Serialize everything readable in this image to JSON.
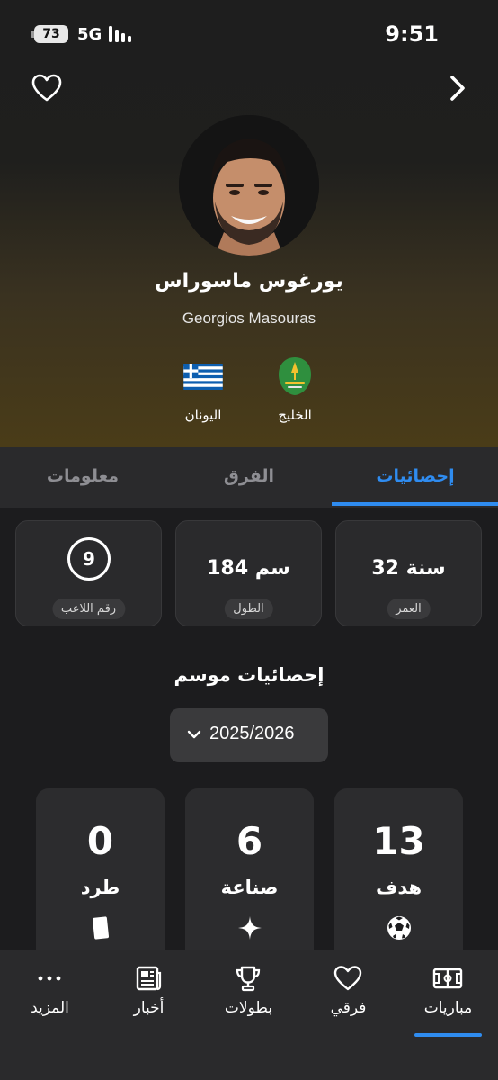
{
  "status_bar": {
    "battery": "73",
    "network": "5G",
    "time": "9:51"
  },
  "header": {
    "favorite_icon": "heart-outline-icon",
    "back_icon": "chevron-right-icon",
    "player_name_ar": "يورغوس ماسوراس",
    "player_name_en": "Georgios Masouras",
    "country": "اليونان",
    "club": "الخليج"
  },
  "tabs": [
    {
      "label": "إحصائيات",
      "active": true
    },
    {
      "label": "الفرق",
      "active": false
    },
    {
      "label": "معلومات",
      "active": false
    }
  ],
  "info_cards": {
    "age": {
      "value": "32 سنة",
      "label": "العمر"
    },
    "height": {
      "value": "184 سم",
      "label": "الطول"
    },
    "number": {
      "value": "9",
      "label": "رقم اللاعب"
    }
  },
  "season": {
    "title": "إحصائيات موسم",
    "selected": "2025/2026"
  },
  "stats": [
    {
      "value": "13",
      "label": "هدف",
      "icon": "soccer-ball-icon"
    },
    {
      "value": "6",
      "label": "صناعة",
      "icon": "sparkle-icon"
    },
    {
      "value": "0",
      "label": "طرد",
      "icon": "red-card-icon"
    }
  ],
  "bottom_nav": [
    {
      "label": "مباريات",
      "icon": "pitch-icon",
      "active": true
    },
    {
      "label": "فرقي",
      "icon": "heart-icon",
      "active": false
    },
    {
      "label": "بطولات",
      "icon": "trophy-icon",
      "active": false
    },
    {
      "label": "أخبار",
      "icon": "newspaper-icon",
      "active": false
    },
    {
      "label": "المزيد",
      "icon": "more-dots-icon",
      "active": false
    }
  ],
  "colors": {
    "accent": "#2f8cf0",
    "background": "#1c1c1e",
    "card": "#2a2a2c"
  }
}
